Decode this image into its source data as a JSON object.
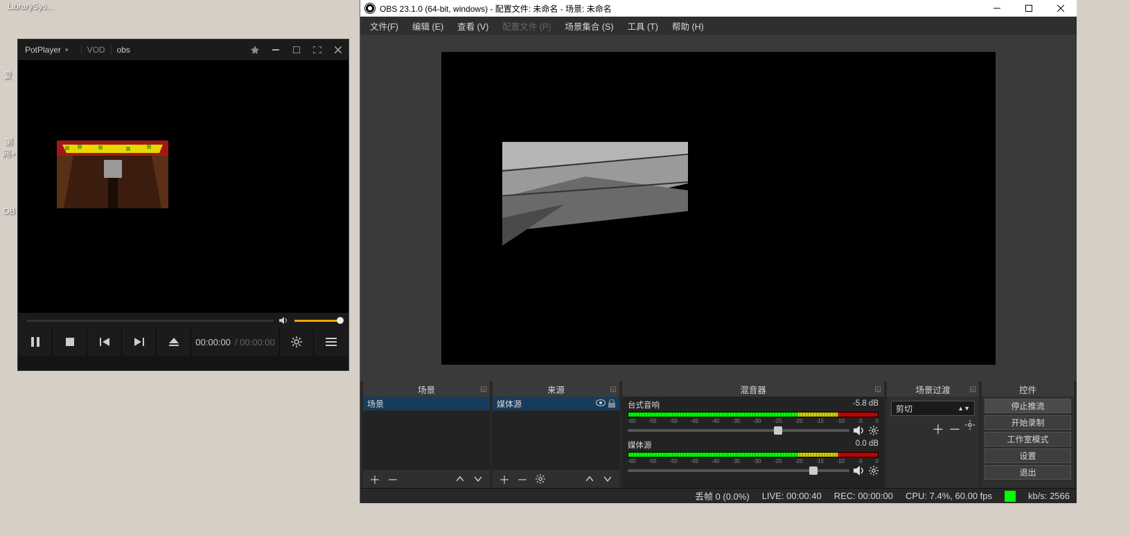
{
  "desktop": {
    "icon1": "LibrarySys...",
    "icon2": "爱",
    "icon3": "第\n网+",
    "icon4": "OB"
  },
  "potplayer": {
    "app": "PotPlayer",
    "tab_vod": "VOD",
    "tab_obs": "obs",
    "time_current": "00:00:00",
    "time_sep": "/",
    "time_total": "00:00:00"
  },
  "obs": {
    "title": "OBS 23.1.0 (64-bit, windows) - 配置文件: 未命名 - 场景: 未命名",
    "menu": {
      "file": "文件(F)",
      "edit": "编辑 (E)",
      "view": "查看 (V)",
      "profile": "配置文件 (P)",
      "scenecoll": "场景集合 (S)",
      "tools": "工具 (T)",
      "help": "帮助 (H)"
    },
    "docks": {
      "scenes": {
        "title": "场景",
        "items": [
          "场景"
        ]
      },
      "sources": {
        "title": "来源",
        "items": [
          "媒体源"
        ]
      },
      "mixer": {
        "title": "混音器",
        "channels": [
          {
            "name": "台式音响",
            "db": "-5.8 dB",
            "knob": 66
          },
          {
            "name": "媒体源",
            "db": "0.0 dB",
            "knob": 82
          }
        ],
        "ticks": [
          "-60",
          "-55",
          "-50",
          "-45",
          "-40",
          "-35",
          "-30",
          "-25",
          "-20",
          "-15",
          "-10",
          "-5",
          "0"
        ]
      },
      "transitions": {
        "title": "场景过渡",
        "selected": "剪切"
      },
      "controls": {
        "title": "控件",
        "buttons": [
          "停止推流",
          "开始录制",
          "工作室模式",
          "设置",
          "退出"
        ]
      }
    },
    "status": {
      "drop": "丢帧 0 (0.0%)",
      "live": "LIVE: 00:00:40",
      "rec": "REC: 00:00:00",
      "cpu": "CPU: 7.4%, 60.00 fps",
      "kbps": "kb/s: 2566"
    }
  }
}
